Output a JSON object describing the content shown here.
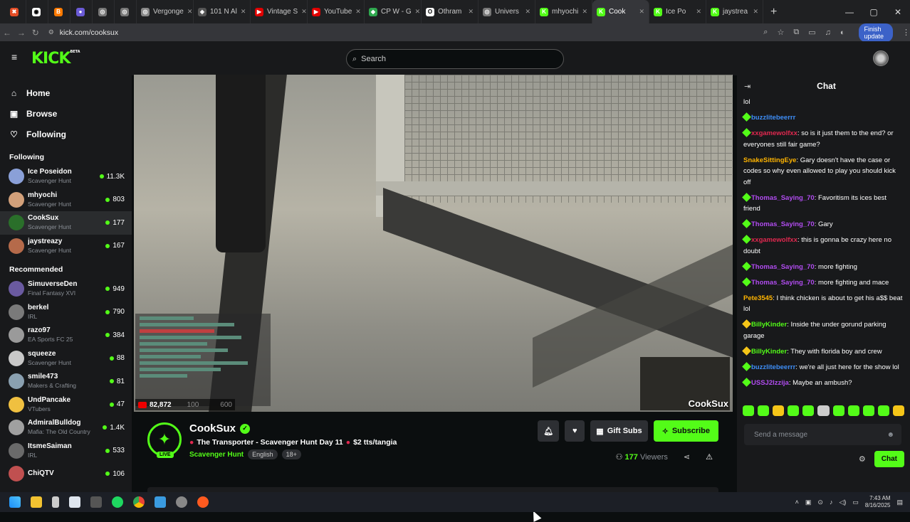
{
  "browser": {
    "tabs": [
      {
        "label": "",
        "color": "#e44d26",
        "glyph": "✖",
        "small": true
      },
      {
        "label": "",
        "color": "#ffffff",
        "glyph": "◉",
        "small": true
      },
      {
        "label": "",
        "color": "#ff7a00",
        "glyph": "B",
        "small": true
      },
      {
        "label": "",
        "color": "#6b5bd6",
        "glyph": "●",
        "small": true
      },
      {
        "label": "",
        "color": "#777777",
        "glyph": "◎",
        "small": true
      },
      {
        "label": "",
        "color": "#777777",
        "glyph": "◎",
        "small": true
      },
      {
        "label": "Vergonge",
        "color": "#888888",
        "glyph": "◎"
      },
      {
        "label": "101 N Al",
        "color": "#555555",
        "glyph": "◈"
      },
      {
        "label": "Vintage S",
        "color": "#e00000",
        "glyph": "▶"
      },
      {
        "label": "YouTube",
        "color": "#e00000",
        "glyph": "▶"
      },
      {
        "label": "CP W - G",
        "color": "#2fa84f",
        "glyph": "◆"
      },
      {
        "label": "Othram",
        "color": "#ffffff",
        "glyph": "O"
      },
      {
        "label": "Univers",
        "color": "#777777",
        "glyph": "◎"
      },
      {
        "label": "mhyochi",
        "color": "#53fc18",
        "glyph": "K"
      },
      {
        "label": "Cook",
        "color": "#53fc18",
        "glyph": "K",
        "active": true
      },
      {
        "label": "Ice Po",
        "color": "#53fc18",
        "glyph": "K"
      },
      {
        "label": "jaystrea",
        "color": "#53fc18",
        "glyph": "K"
      }
    ],
    "url": "kick.com/cooksux",
    "finish_update": "Finish update"
  },
  "kick": {
    "logo": "KICK",
    "logo_badge": "BETA",
    "search_placeholder": "Search",
    "nav": [
      {
        "label": "Home",
        "icon": "home-icon",
        "glyph": "⌂"
      },
      {
        "label": "Browse",
        "icon": "browse-icon",
        "glyph": "▣"
      },
      {
        "label": "Following",
        "icon": "heart-icon",
        "glyph": "♡"
      }
    ],
    "following_header": "Following",
    "following": [
      {
        "name": "Ice Poseidon",
        "category": "Scavenger Hunt",
        "viewers": "11.3K",
        "avatar": "#8aa0d8"
      },
      {
        "name": "mhyochi",
        "category": "Scavenger Hunt",
        "viewers": "803",
        "avatar": "#d2a07a"
      },
      {
        "name": "CookSux",
        "category": "Scavenger Hunt",
        "viewers": "177",
        "avatar": "#2a6f2a",
        "active": true
      },
      {
        "name": "jaystreazy",
        "category": "Scavenger Hunt",
        "viewers": "167",
        "avatar": "#b56a4a"
      }
    ],
    "recommended_header": "Recommended",
    "recommended": [
      {
        "name": "SimuverseDen",
        "category": "Final Fantasy XVI",
        "viewers": "949",
        "avatar": "#6a5aa0"
      },
      {
        "name": "berkel",
        "category": "IRL",
        "viewers": "790",
        "avatar": "#7a7a7a"
      },
      {
        "name": "razo97",
        "category": "EA Sports FC 25",
        "viewers": "384",
        "avatar": "#9a9a9a"
      },
      {
        "name": "squeeze",
        "category": "Scavenger Hunt",
        "viewers": "88",
        "avatar": "#c8c8c8"
      },
      {
        "name": "smile473",
        "category": "Makers & Crafting",
        "viewers": "81",
        "avatar": "#8aa0b0"
      },
      {
        "name": "UndPancake",
        "category": "VTubers",
        "viewers": "47",
        "avatar": "#f0c040"
      },
      {
        "name": "AdmiralBulldog",
        "category": "Mafia: The Old Country",
        "viewers": "1.4K",
        "avatar": "#a0a0a0"
      },
      {
        "name": "ItsmeSaiman",
        "category": "IRL",
        "viewers": "533",
        "avatar": "#6a6a6a"
      },
      {
        "name": "ChiQTV",
        "category": "",
        "viewers": "106",
        "avatar": "#c05050"
      }
    ]
  },
  "player": {
    "overlay_viewers": "82,872",
    "overlay_stat1": "100",
    "overlay_stat2": "600",
    "cam_label": "CookSux"
  },
  "streamer": {
    "name": "CookSux",
    "live": "LIVE",
    "title": "The Transporter - Scavenger Hunt Day 11",
    "title_suffix": "$2 tts/tangia",
    "category": "Scavenger Hunt",
    "tags": [
      "English",
      "18+"
    ],
    "gift_subs": "Gift Subs",
    "subscribe": "Subscribe",
    "viewers_count": "177",
    "viewers_label": "Viewers"
  },
  "chat": {
    "title": "Chat",
    "messages": [
      {
        "user": "",
        "color": "#ffffff",
        "text": "lol",
        "badge": ""
      },
      {
        "user": "buzzlitebeerrr",
        "color": "#3e8ef7",
        "text": "",
        "badge": "#53fc18"
      },
      {
        "user": "xxgamewolfxx",
        "color": "#e0284f",
        "text": "so is it just them to the end? or everyones still fair game?",
        "badge": "#53fc18"
      },
      {
        "user": "SnakeSittingEye",
        "color": "#ffb400",
        "text": "Gary doesn't have the case or codes so why even allowed to play you should kick off",
        "badge": ""
      },
      {
        "user": "Thomas_Saying_70",
        "color": "#b14cf0",
        "text": "Favoritism its ices best friend",
        "badge": "#53fc18"
      },
      {
        "user": "Thomas_Saying_70",
        "color": "#b14cf0",
        "text": "Gary",
        "badge": "#53fc18"
      },
      {
        "user": "xxgamewolfxx",
        "color": "#e0284f",
        "text": "this is gonna be crazy here no doubt",
        "badge": "#53fc18"
      },
      {
        "user": "Thomas_Saying_70",
        "color": "#b14cf0",
        "text": "more fighting",
        "badge": "#53fc18"
      },
      {
        "user": "Thomas_Saying_70",
        "color": "#b14cf0",
        "text": "more fighting and mace",
        "badge": "#53fc18"
      },
      {
        "user": "Pete3545",
        "color": "#ffb400",
        "text": "I think chicken is about to get his a$$ beat lol",
        "badge": ""
      },
      {
        "user": "BillyKinder",
        "color": "#53fc18",
        "text": "Inside the under gorund parking garage",
        "badge": "#f5c518"
      },
      {
        "user": "BillyKinder",
        "color": "#53fc18",
        "text": "They with florida boy and crew",
        "badge": "#f5c518"
      },
      {
        "user": "buzzlitebeerrr",
        "color": "#3e8ef7",
        "text": "we're all just here for the show lol",
        "badge": "#53fc18"
      },
      {
        "user": "USSJ2lzzija",
        "color": "#b14cf0",
        "text": "Maybe an ambush?",
        "badge": "#53fc18"
      }
    ],
    "input_placeholder": "Send a message",
    "send": "Chat"
  },
  "system": {
    "time": "7:43 AM",
    "date": "8/16/2025"
  }
}
